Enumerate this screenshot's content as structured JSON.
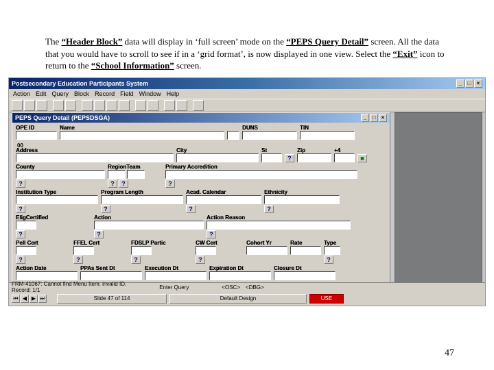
{
  "doc": {
    "paragraph_parts": {
      "p1a": "The ",
      "p1b": "“Header Block”",
      "p1c": " data will display in ‘full screen’ mode on the ",
      "p1d": "“PEPS Query Detail”",
      "p1e": " screen.  All the data that you would have to scroll to see if in a ‘grid format’, is now displayed in one view.  Select the ",
      "p1f": "“Exit”",
      "p1g": " icon to return to the ",
      "p1h": "“School Information”",
      "p1i": " screen."
    },
    "page_number": "47"
  },
  "app": {
    "outer_title": "Postsecondary Education Participants System",
    "menus": [
      "Action",
      "Edit",
      "Query",
      "Block",
      "Record",
      "Field",
      "Window",
      "Help"
    ],
    "child_title": "PEPS Query Detail (PEPSDSGA)",
    "status_line1a": "FRM-41067: Cannot find Menu Item: invalid ID.",
    "status_line1b": "Record: 1/1",
    "status_line1c": "Enter Query",
    "status_seg_osc": "<OSC>",
    "status_seg_dbg": "<DBG>",
    "tab_slide": "Slide 47 of 114",
    "tab_design": "Default Design",
    "tab_lang": "USE"
  },
  "fields": {
    "ope_id": "OPE ID",
    "oo": "00",
    "name": "Name",
    "duns": "DUNS",
    "tin": "TIN",
    "address": "Address",
    "city": "City",
    "st": "St",
    "zip": "Zip",
    "plus4": "+4",
    "county": "County",
    "region_team": "RegionTeam",
    "primary_accred": "Primary Accredition",
    "inst_type": "Institution Type",
    "prog_length": "Program Length",
    "acad_cal": "Acad. Calendar",
    "ethnicity": "Ethnicity",
    "elig_cert": "EligCertified",
    "action": "Action",
    "action_reason": "Action Reason",
    "pell_cert": "Pell Cert",
    "ffel_cert": "FFEL Cert",
    "fdslp_partic": "FDSLP Partic",
    "cw_cert": "CW Cert",
    "cohort_yr": "Cohort Yr",
    "rate": "Rate",
    "type": "Type",
    "action_date": "Action Date",
    "ppas_sent_dt": "PPAs Sent Dt",
    "exec_dt": "Execution Dt",
    "expir_dt": "Expiration Dt",
    "closure_dt": "Closure Dt"
  }
}
